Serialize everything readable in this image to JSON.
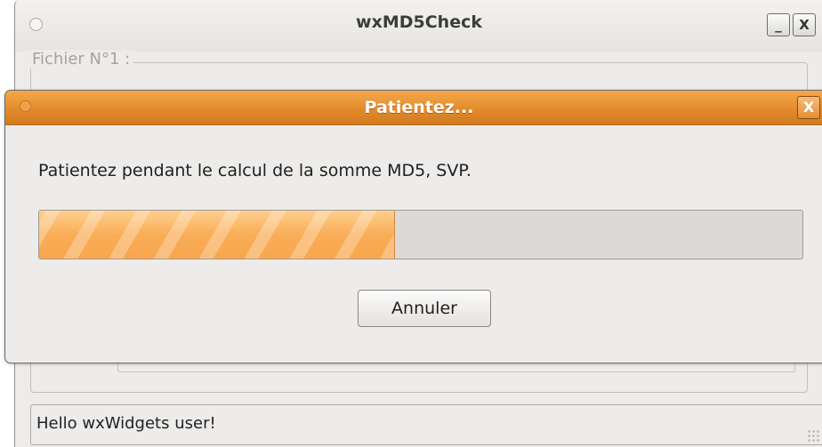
{
  "main_window": {
    "title": "wxMD5Check",
    "minimize_glyph": "_",
    "close_glyph": "X",
    "file_group_label": "Fichier N°1 :",
    "status_text": "Hello wxWidgets user!"
  },
  "dialog": {
    "title": "Patientez...",
    "close_glyph": "X",
    "message": "Patientez pendant le calcul de la somme MD5, SVP.",
    "progress": 0.465,
    "cancel_label": "Annuler"
  },
  "colors": {
    "dialog_titlebar": "#e1892a",
    "progress_fill": "#f9ad57",
    "window_bg": "#edeceb"
  }
}
